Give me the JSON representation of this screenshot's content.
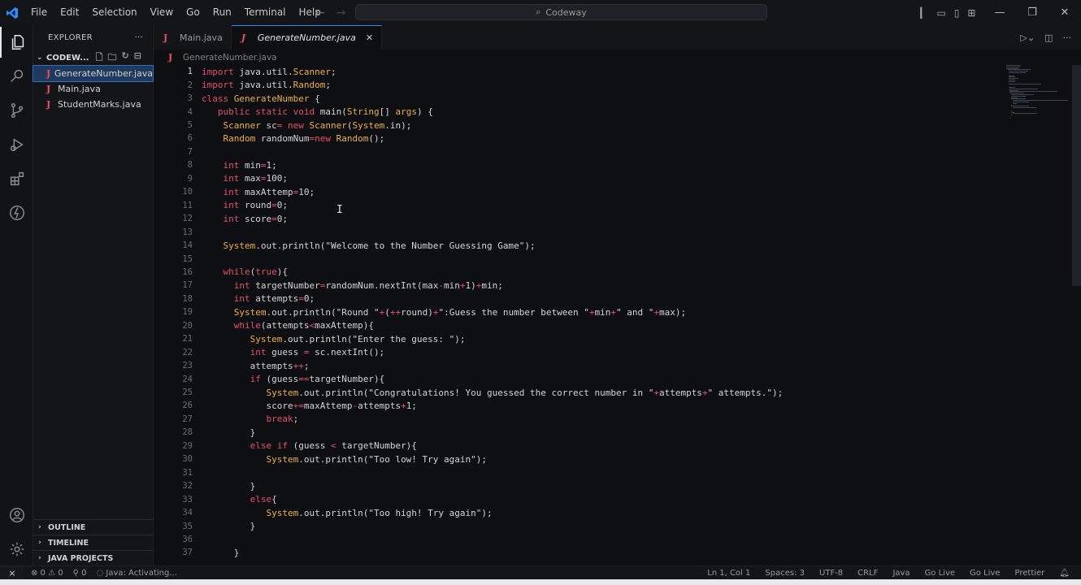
{
  "titlebar": {
    "logo": "VS",
    "menu": [
      "File",
      "Edit",
      "Selection",
      "View",
      "Go",
      "Run",
      "Terminal",
      "Help"
    ],
    "search_text": "Codeway",
    "window_controls": [
      "—",
      "❐",
      "✕"
    ]
  },
  "sidebar": {
    "header": "EXPLORER",
    "more": "···",
    "folder": "CODEW...",
    "files": [
      {
        "icon": "J",
        "name": "GenerateNumber.java"
      },
      {
        "icon": "J",
        "name": "Main.java"
      },
      {
        "icon": "J",
        "name": "StudentMarks.java"
      }
    ],
    "sections": [
      "OUTLINE",
      "TIMELINE",
      "JAVA PROJECTS"
    ]
  },
  "tabs": [
    {
      "icon": "J",
      "label": "Main.java"
    },
    {
      "icon": "J",
      "label": "GenerateNumber.java",
      "close": "✕"
    }
  ],
  "breadcrumb": {
    "icon": "J",
    "label": "GenerateNumber.java"
  },
  "code_lines": [
    "import java.util.Scanner;",
    "import java.util.Random;",
    "class GenerateNumber {",
    "   public static void main(String[] args) {",
    "    Scanner sc= new Scanner(System.in);",
    "    Random randomNum=new Random();",
    "",
    "    int min=1;",
    "    int max=100;",
    "    int maxAttemp=10;",
    "    int round=0;",
    "    int score=0;",
    "",
    "    System.out.println(\"Welcome to the Number Guessing Game\");",
    "",
    "    while(true){",
    "      int targetNumber=randomNum.nextInt(max-min+1)+min;",
    "      int attempts=0;",
    "      System.out.println(\"Round \"+(++round)+\":Guess the number between \"+min+\" and \"+max);",
    "      while(attempts<maxAttemp){",
    "         System.out.println(\"Enter the guess: \");",
    "         int guess = sc.nextInt();",
    "         attempts++;",
    "         if (guess==targetNumber){",
    "            System.out.println(\"Congratulations! You guessed the correct number in \"+attempts+\" attempts.\");",
    "            score+=maxAttemp-attempts+1;",
    "            break;",
    "         }",
    "         else if (guess < targetNumber){",
    "            System.out.println(\"Too low! Try again\");",
    "",
    "         }",
    "         else{",
    "            System.out.println(\"Too high! Try again\");",
    "         }",
    "",
    "      }"
  ],
  "statusbar": {
    "remote": "⨯",
    "problems": "⊗ 0 ⚠ 0",
    "ports": "⚲ 0",
    "java_status": "Java: Activating...",
    "right": [
      "Ln 1, Col 1",
      "Spaces: 3",
      "UTF-8",
      "CRLF",
      "Java",
      "Go Live",
      "Go Live",
      "Prettier"
    ]
  },
  "colors": {
    "keyword": "#e6506a",
    "class": "#f0b04c",
    "accent": "#2f8cff",
    "java_icon": "#e8505b"
  }
}
